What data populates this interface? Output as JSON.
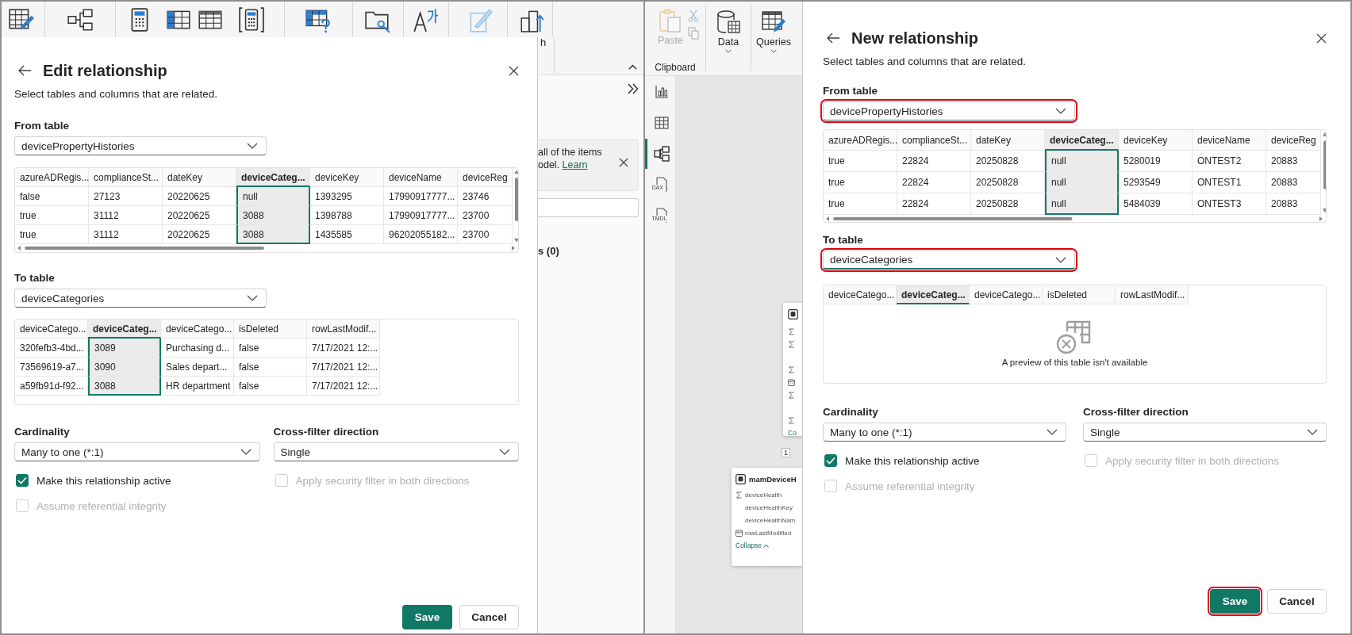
{
  "left_window": {
    "ribbon": {
      "cut_label": "h"
    },
    "fields_pane": {
      "banner_line": "all of the items",
      "banner_text": "odel.",
      "banner_link": "Learn",
      "section": "s (0)"
    },
    "dialog": {
      "title": "Edit relationship",
      "subtitle": "Select tables and columns that are related.",
      "from": {
        "label": "From table",
        "value": "devicePropertyHistories",
        "highlighted": false,
        "focused": false
      },
      "from_table": {
        "columns": [
          {
            "label": "azureADRegis...",
            "selected": false
          },
          {
            "label": "complianceSt...",
            "selected": false
          },
          {
            "label": "dateKey",
            "selected": false
          },
          {
            "label": "deviceCateg...",
            "selected": true
          },
          {
            "label": "deviceKey",
            "selected": false
          },
          {
            "label": "deviceName",
            "selected": false
          },
          {
            "label": "deviceReg",
            "selected": false
          }
        ],
        "rows": [
          [
            "false",
            "27123",
            "20220625",
            "null",
            "1393295",
            "17990917777...",
            "23746"
          ],
          [
            "true",
            "31112",
            "20220625",
            "3088",
            "1398788",
            "17990917777...",
            "23700"
          ],
          [
            "true",
            "31112",
            "20220625",
            "3088",
            "1435585",
            "96202055182...",
            "23700"
          ]
        ]
      },
      "to": {
        "label": "To table",
        "value": "deviceCategories",
        "highlighted": false,
        "focused": false
      },
      "to_table": {
        "columns": [
          {
            "label": "deviceCatego...",
            "selected": false
          },
          {
            "label": "deviceCateg...",
            "selected": true
          },
          {
            "label": "deviceCatego...",
            "selected": false
          },
          {
            "label": "isDeleted",
            "selected": false
          },
          {
            "label": "rowLastModif...",
            "selected": false
          }
        ],
        "rows": [
          [
            "320fefb3-4bd...",
            "3089",
            "Purchasing d...",
            "false",
            "7/17/2021 12:..."
          ],
          [
            "73569619-a7...",
            "3090",
            "Sales depart...",
            "false",
            "7/17/2021 12:..."
          ],
          [
            "a59fb91d-f92...",
            "3088",
            "HR department",
            "false",
            "7/17/2021 12:..."
          ]
        ]
      },
      "cardinality": {
        "label": "Cardinality",
        "value": "Many to one (*:1)"
      },
      "cross_filter": {
        "label": "Cross-filter direction",
        "value": "Single"
      },
      "options": [
        {
          "label": "Make this relationship active",
          "checked": true,
          "disabled": false
        },
        {
          "label": "Apply security filter in both directions",
          "checked": false,
          "disabled": true
        },
        {
          "label": "Assume referential integrity",
          "checked": false,
          "disabled": true
        }
      ],
      "save": {
        "label": "Save",
        "highlighted": false
      },
      "cancel": "Cancel"
    }
  },
  "right_window": {
    "ribbon": {
      "buttons": [
        {
          "kind": "paste",
          "label": "Paste",
          "disabled": true,
          "dropdown": false
        },
        {
          "kind": "data",
          "label": "Data",
          "disabled": false,
          "dropdown": true
        },
        {
          "kind": "queries",
          "label": "Queries",
          "disabled": false,
          "dropdown": true
        }
      ],
      "group_label": "Clipboard"
    },
    "rail": [
      {
        "kind": "report",
        "selected": false
      },
      {
        "kind": "table",
        "selected": false
      },
      {
        "kind": "model",
        "selected": true
      },
      {
        "kind": "file",
        "label": "DAX",
        "selected": false
      },
      {
        "kind": "file",
        "label": "TMDL",
        "selected": false
      }
    ],
    "canvas": {
      "connector_label": "1",
      "tables": [
        {
          "fields": [
            {
              "kind": "sum"
            },
            {
              "kind": "sum"
            },
            {
              "kind": "none"
            },
            {
              "kind": "sum"
            },
            {
              "kind": "date"
            },
            {
              "kind": "sum"
            },
            {
              "kind": "none"
            },
            {
              "kind": "sum"
            }
          ],
          "footer": "Co"
        },
        {
          "name": "mamDeviceH",
          "fields": [
            {
              "kind": "sum",
              "label": "deviceHealth"
            },
            {
              "kind": "none",
              "label": "deviceHealthKey"
            },
            {
              "kind": "none",
              "label": "deviceHealthNam"
            },
            {
              "kind": "date",
              "label": "rowLastModified"
            }
          ],
          "footer": "Collapse"
        }
      ]
    },
    "dialog": {
      "title": "New relationship",
      "subtitle": "Select tables and columns that are related.",
      "from": {
        "label": "From table",
        "value": "devicePropertyHistories",
        "highlighted": true,
        "focused": false
      },
      "from_table": {
        "columns": [
          {
            "label": "azureADRegis...",
            "selected": false
          },
          {
            "label": "complianceSt...",
            "selected": false
          },
          {
            "label": "dateKey",
            "selected": false
          },
          {
            "label": "deviceCateg...",
            "selected": true
          },
          {
            "label": "deviceKey",
            "selected": false
          },
          {
            "label": "deviceName",
            "selected": false
          },
          {
            "label": "deviceReg",
            "selected": false
          }
        ],
        "rows": [
          [
            "true",
            "22824",
            "20250828",
            "null",
            "5280019",
            "ONTEST2",
            "20883"
          ],
          [
            "true",
            "22824",
            "20250828",
            "null",
            "5293549",
            "ONTEST1",
            "20883"
          ],
          [
            "true",
            "22824",
            "20250828",
            "null",
            "5484039",
            "ONTEST3",
            "20883"
          ]
        ]
      },
      "to": {
        "label": "To table",
        "value": "deviceCategories",
        "highlighted": true,
        "focused": true
      },
      "to_table": {
        "columns": [
          {
            "label": "deviceCatego...",
            "selected": false
          },
          {
            "label": "deviceCateg...",
            "selected": true
          },
          {
            "label": "deviceCatego...",
            "selected": false
          },
          {
            "label": "isDeleted",
            "selected": false
          },
          {
            "label": "rowLastModif...",
            "selected": false
          }
        ],
        "preview_message": "A preview of this table isn't available"
      },
      "cardinality": {
        "label": "Cardinality",
        "value": "Many to one (*:1)"
      },
      "cross_filter": {
        "label": "Cross-filter direction",
        "value": "Single"
      },
      "options": [
        {
          "label": "Make this relationship active",
          "checked": true,
          "disabled": false
        },
        {
          "label": "Apply security filter in both directions",
          "checked": false,
          "disabled": true
        },
        {
          "label": "Assume referential integrity",
          "checked": false,
          "disabled": true
        }
      ],
      "save": {
        "label": "Save",
        "highlighted": true
      },
      "cancel": "Cancel"
    }
  }
}
